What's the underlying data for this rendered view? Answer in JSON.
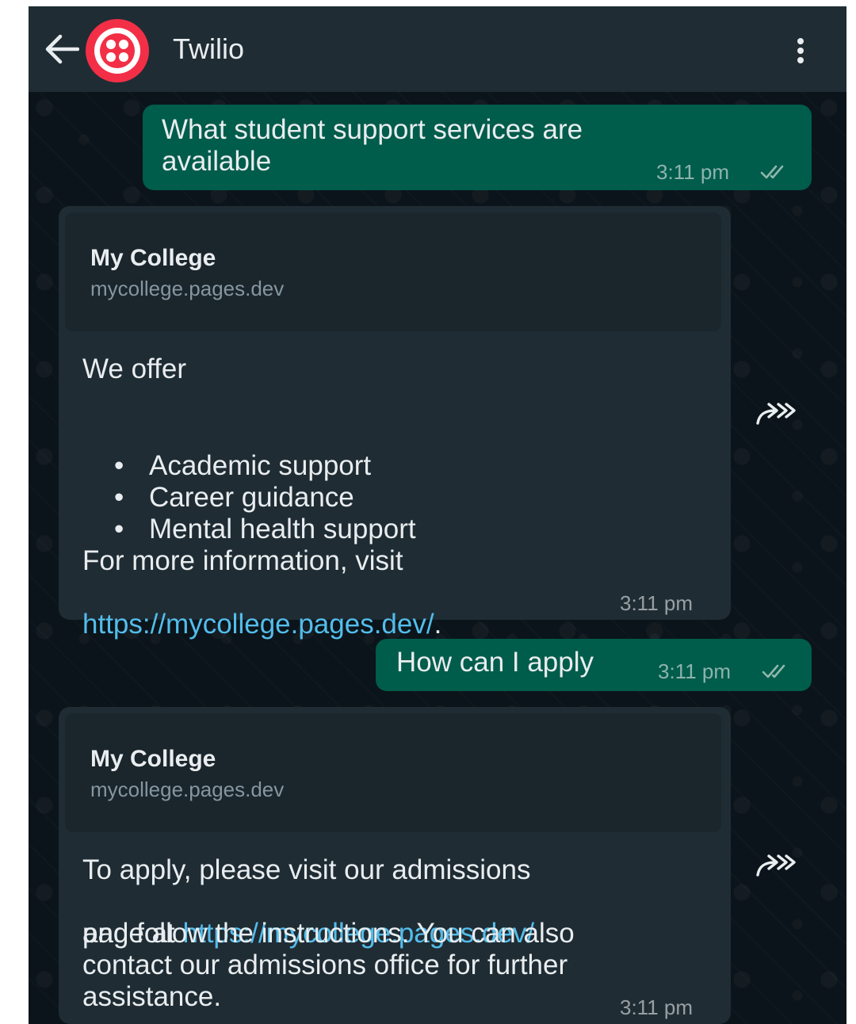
{
  "header": {
    "title": "Twilio"
  },
  "messages": {
    "m1": {
      "text": "What student support services are\navailable",
      "time": "3:11 pm"
    },
    "m2": {
      "preview_title": "My College",
      "preview_domain": "mycollege.pages.dev",
      "intro": "We offer",
      "items": [
        "Academic support",
        "Career guidance",
        "Mental health support"
      ],
      "outro": "For more information, visit",
      "link": "https://mycollege.pages.dev/",
      "link_suffix": ".",
      "time": "3:11 pm"
    },
    "m3": {
      "text": "How can I apply",
      "time": "3:11 pm"
    },
    "m4": {
      "preview_title": "My College",
      "preview_domain": "mycollege.pages.dev",
      "line1": "To apply, please visit our admissions",
      "line2_prefix": "page at ",
      "link": "https://mycollege.pages.dev/",
      "rest": "and follow the instructions. You can also\ncontact our admissions office for further\nassistance.",
      "time": "3:11 pm"
    }
  },
  "colors": {
    "background": "#0b141a",
    "header": "#1f2c34",
    "outgoing_bubble": "#005c4b",
    "incoming_bubble": "#1f2c34",
    "link": "#53bdeb",
    "brand": "#f22f46",
    "read_ticks": "#8fb7ad"
  },
  "icons": {
    "back": "arrow-left-icon",
    "avatar": "twilio-logo",
    "menu": "more-vertical-icon",
    "ticks": "double-check-icon",
    "forward": "forward-icon"
  }
}
